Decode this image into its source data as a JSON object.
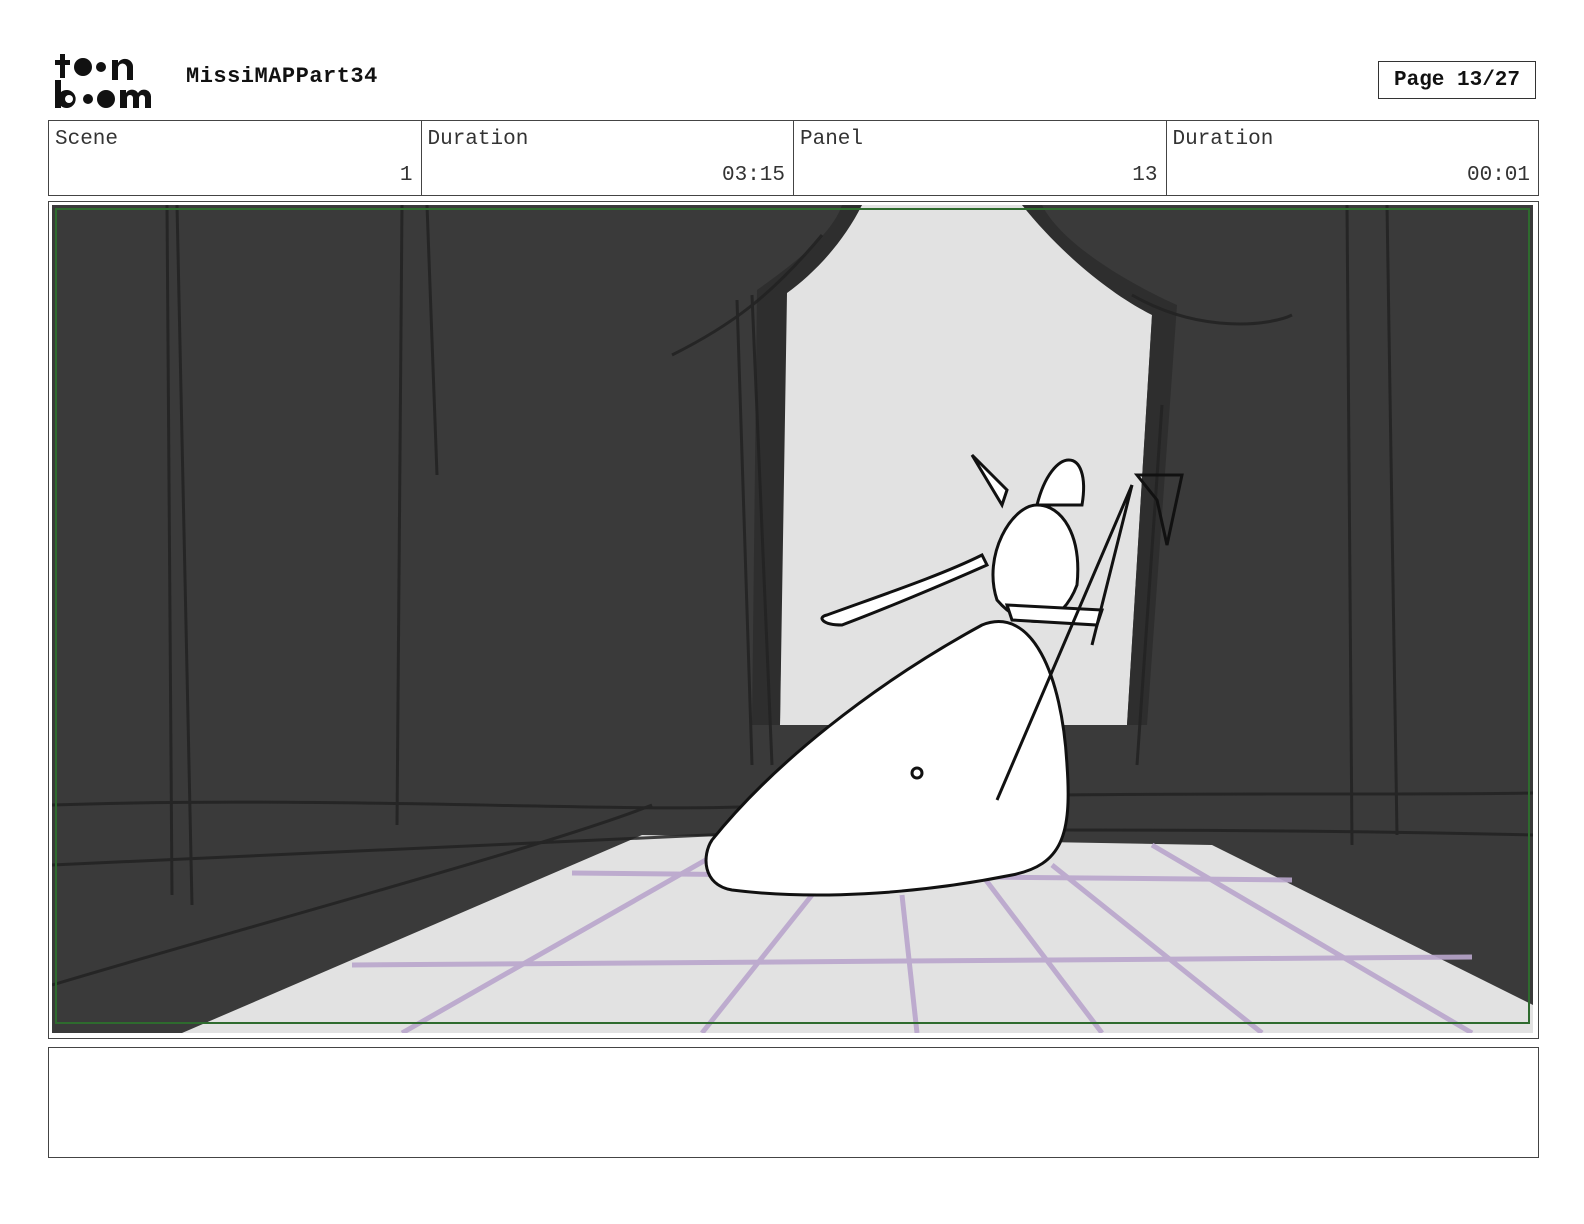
{
  "header": {
    "logo_text": "toon boom",
    "project_title": "MissiMAPPart34",
    "page_label": "Page 13/27"
  },
  "info": {
    "scene_label": "Scene",
    "scene_value": "1",
    "scene_duration_label": "Duration",
    "scene_duration_value": "03:15",
    "panel_label": "Panel",
    "panel_value": "13",
    "panel_duration_label": "Duration",
    "panel_duration_value": "00:01"
  },
  "panel": {
    "icon": "storyboard-sketch-elf-with-staff",
    "colors": {
      "background_dark": "#3a3a3a",
      "light_floor": "#e2e2e2",
      "grid_lines": "#b9a6cc",
      "safe_frame": "#2e6b2e"
    }
  },
  "notes": {
    "text": ""
  }
}
